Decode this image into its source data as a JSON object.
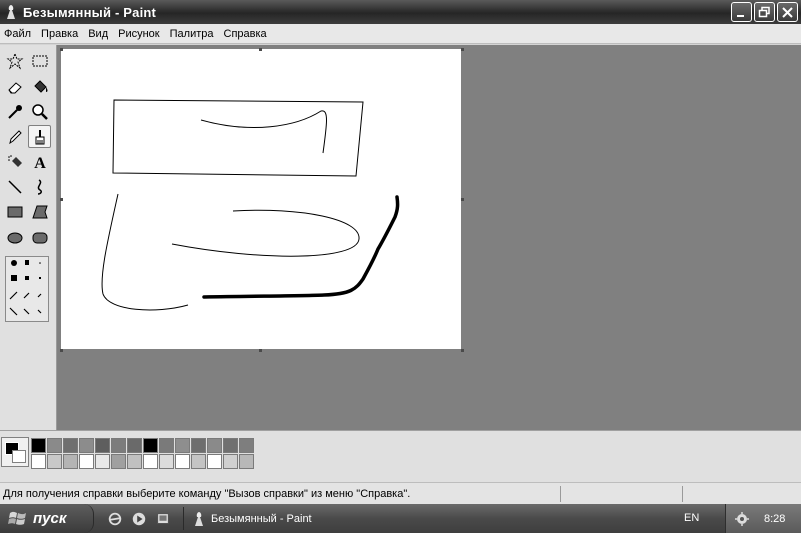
{
  "window": {
    "title": "Безымянный - Paint"
  },
  "menu": [
    "Файл",
    "Правка",
    "Вид",
    "Рисунок",
    "Палитра",
    "Справка"
  ],
  "tools": [
    "free-select",
    "rect-select",
    "eraser",
    "fill-bucket",
    "color-picker",
    "magnifier",
    "pencil",
    "brush",
    "airbrush",
    "text",
    "line",
    "curve",
    "rectangle",
    "polygon",
    "ellipse",
    "rounded-rectangle"
  ],
  "active_tool": "brush",
  "text_tool_glyph": "A",
  "colors": {
    "foreground": "#000000",
    "background": "#ffffff",
    "palette_top": [
      "#000000",
      "#8a8a8a",
      "#6f6f6f",
      "#8c8c8c",
      "#5e5e5e",
      "#7c7c7c",
      "#6a6a6a",
      "#000000",
      "#7a7a7a",
      "#8e8e8e",
      "#6e6e6e",
      "#8a8a8a",
      "#707070",
      "#7e7e7e"
    ],
    "palette_bottom": [
      "#ffffff",
      "#c8c8c8",
      "#b4b4b4",
      "#ffffff",
      "#e8e8e8",
      "#a0a0a0",
      "#c0c0c0",
      "#ffffff",
      "#dcdcdc",
      "#ffffff",
      "#c4c4c4",
      "#ffffff",
      "#d0d0d0",
      "#b8b8b8"
    ]
  },
  "status": {
    "help_text": "Для получения справки выберите команду \"Вызов справки\" из меню \"Справка\"."
  },
  "taskbar": {
    "start_label": "пуск",
    "task_label": "Безымянный - Paint",
    "language": "EN",
    "clock": "8:28"
  }
}
